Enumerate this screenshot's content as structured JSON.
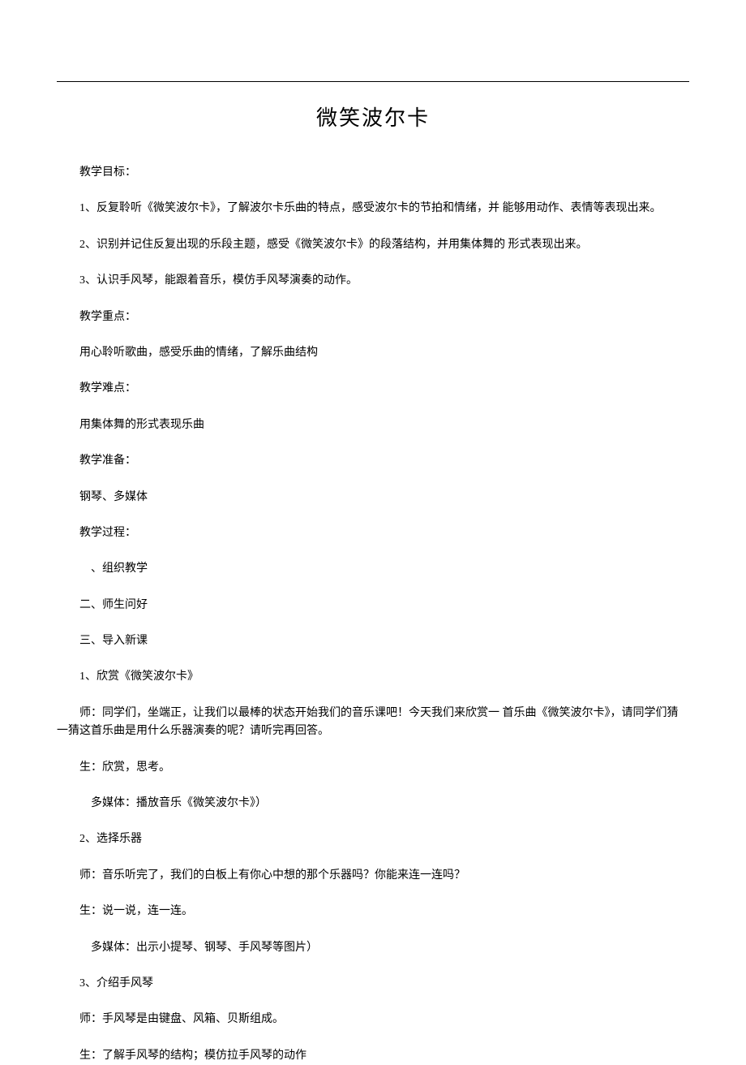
{
  "title": "微笑波尔卡",
  "sections": {
    "goals_label": "教学目标：",
    "goal1": "1、反复聆听《微笑波尔卡》，了解波尔卡乐曲的特点，感受波尔卡的节拍和情绪，并 能够用动作、表情等表现出来。",
    "goal2": "2、识别并记住反复出现的乐段主题，感受《微笑波尔卡》的段落结构，并用集体舞的 形式表现出来。",
    "goal3": "3、认识手风琴，能跟着音乐，模仿手风琴演奏的动作。",
    "focus_label": "教学重点：",
    "focus_content": "用心聆听歌曲，感受乐曲的情绪，了解乐曲结构",
    "difficulty_label": "教学难点：",
    "difficulty_content": "用集体舞的形式表现乐曲",
    "prep_label": "教学准备：",
    "prep_content": "钢琴、多媒体",
    "process_label": "教学过程：",
    "process_1": "、组织教学",
    "process_2": "二、师生问好",
    "process_3": "三、导入新课",
    "step1_label": "1、欣赏《微笑波尔卡》",
    "step1_teacher": "师：同学们，坐端正，让我们以最棒的状态开始我们的音乐课吧！今天我们来欣赏一 首乐曲《微笑波尔卡》，请同学们猜一猜这首乐曲是用什么乐器演奏的呢？请听完再回答。",
    "step1_student": "生：欣赏，思考。",
    "step1_media": "多媒体：播放音乐《微笑波尔卡》）",
    "step2_label": "2、选择乐器",
    "step2_teacher": "师：音乐听完了，我们的白板上有你心中想的那个乐器吗？你能来连一连吗？",
    "step2_student": "生：说一说，连一连。",
    "step2_media": "多媒体：出示小提琴、钢琴、手风琴等图片）",
    "step3_label": "3、介绍手风琴",
    "step3_teacher": "师：手风琴是由键盘、风箱、贝斯组成。",
    "step3_student": "生：了解手风琴的结构；模仿拉手风琴的动作"
  }
}
